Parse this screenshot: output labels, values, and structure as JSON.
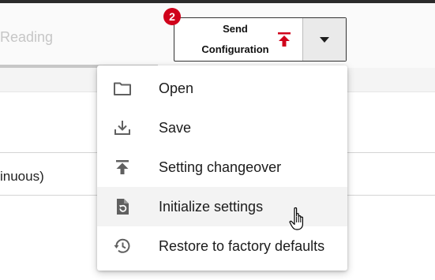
{
  "tab": {
    "label": "Reading"
  },
  "field": {
    "value": "inuous)"
  },
  "send_button": {
    "label_line1": "Send",
    "label_line2": "Configuration",
    "badge_count": "2",
    "icon": "upload-icon",
    "dropdown_icon": "caret-down-icon"
  },
  "menu": {
    "items": [
      {
        "label": "Open",
        "icon": "folder-icon"
      },
      {
        "label": "Save",
        "icon": "download-icon"
      },
      {
        "label": "Setting changeover",
        "icon": "upload-icon"
      },
      {
        "label": "Initialize settings",
        "icon": "file-reset-icon"
      },
      {
        "label": "Restore to factory defaults",
        "icon": "history-icon"
      }
    ],
    "hovered_index": 3
  },
  "colors": {
    "accent": "#d0021b",
    "icon_gray": "#606060",
    "hover_bg": "#f3f3f3"
  }
}
